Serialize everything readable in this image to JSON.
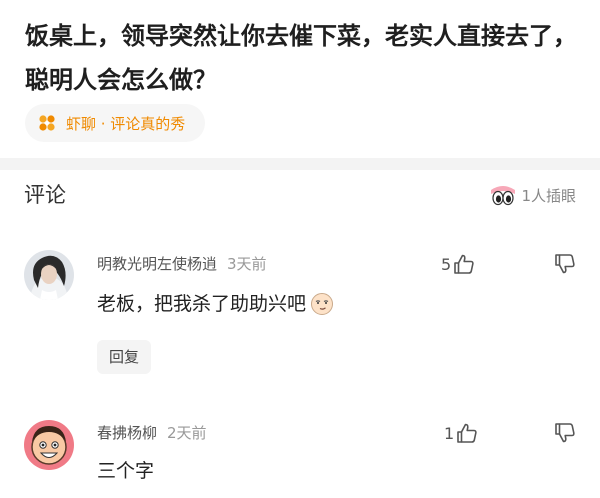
{
  "question": {
    "title": "饭桌上，领导突然让你去催下菜，老实人直接去了，聪明人会怎么做？"
  },
  "topic": {
    "label": "虾聊 · 评论真的秀",
    "icon": "flower-icon",
    "color": "#f08a00"
  },
  "comments_section": {
    "heading": "评论",
    "watchers_label": "1人插眼",
    "watchers_icon": "eyes-icon"
  },
  "comments": [
    {
      "username": "明教光明左使杨逍",
      "time": "3天前",
      "likes": "5",
      "text": "老板，把我杀了助助兴吧",
      "reply_label": "回复"
    },
    {
      "username": "春拂杨柳",
      "time": "2天前",
      "likes": "1",
      "text": "三个字"
    }
  ]
}
